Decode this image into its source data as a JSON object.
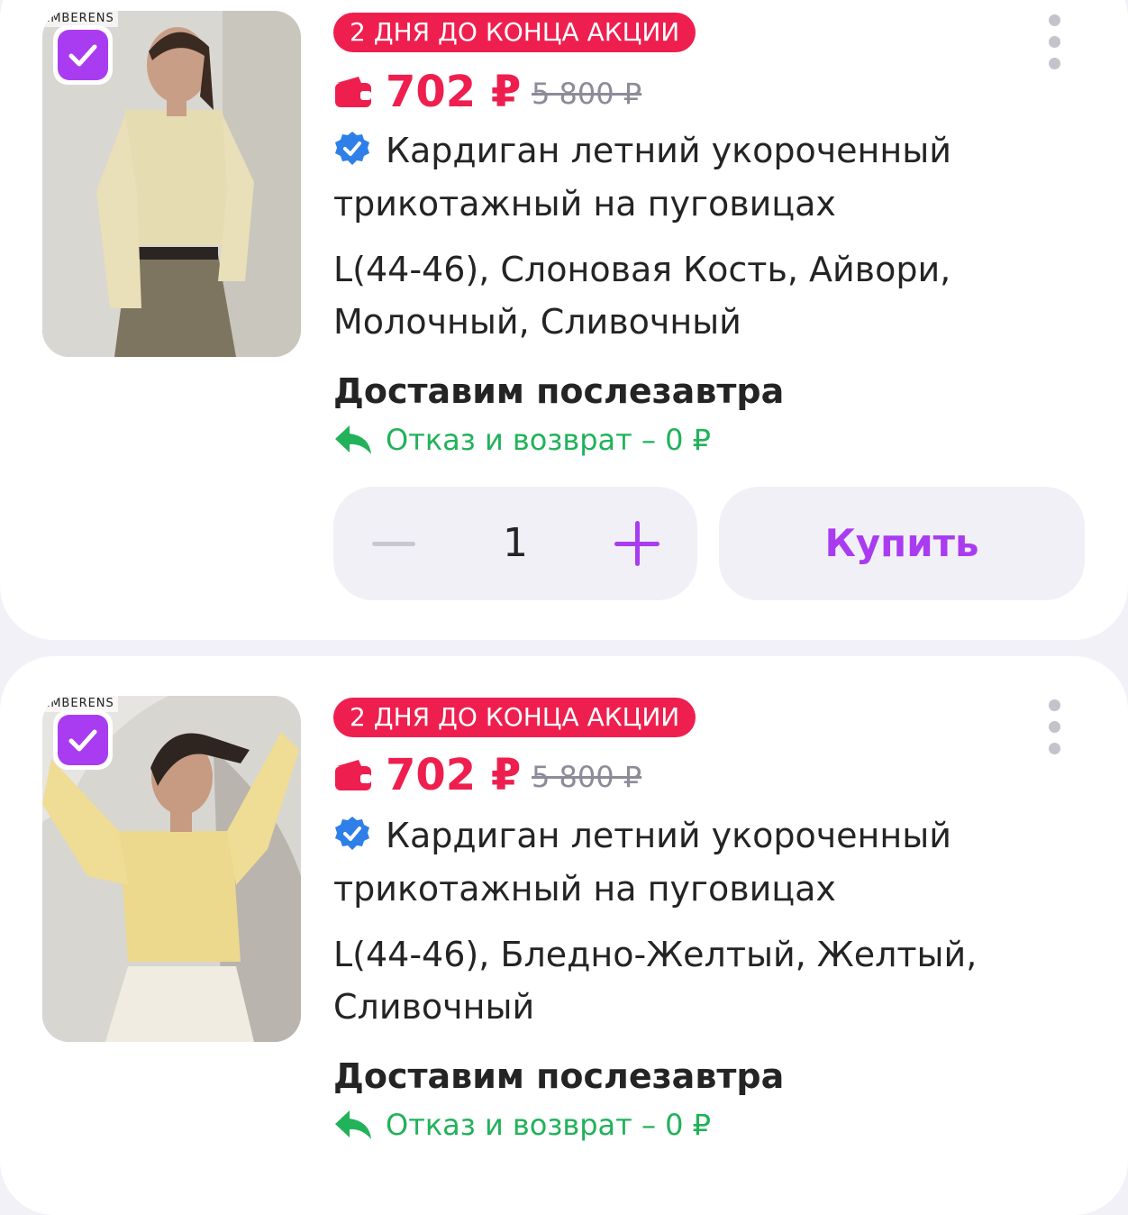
{
  "colors": {
    "accent": "#a93cf0",
    "sale": "#ee1f4e",
    "success": "#21b25a",
    "muted": "#8d8b98"
  },
  "products": [
    {
      "brand_mark": "EMBERENS",
      "selected": true,
      "promo_badge": "2 ДНЯ ДО КОНЦА АКЦИИ",
      "price": "702 ₽",
      "old_price": "5 800 ₽",
      "title": "Кардиган летний укороченный трикотажный на пуговицах",
      "variant": "L(44-46), Слоновая Кость, Айвори, Молочный, Сливочный",
      "delivery": "Доставим послезавтра",
      "return_policy": "Отказ и возврат – 0 ₽",
      "quantity": "1",
      "buy_label": "Купить",
      "icons": [
        "check-icon",
        "wallet-icon",
        "verified-icon",
        "return-arrow-icon",
        "more-vertical-icon",
        "minus-icon",
        "plus-icon"
      ]
    },
    {
      "brand_mark": "EMBERENS",
      "selected": true,
      "promo_badge": "2 ДНЯ ДО КОНЦА АКЦИИ",
      "price": "702 ₽",
      "old_price": "5 800 ₽",
      "title": "Кардиган летний укороченный трикотажный на пуговицах",
      "variant": "L(44-46), Бледно-Желтый, Желтый, Сливочный",
      "delivery": "Доставим послезавтра",
      "return_policy": "Отказ и возврат – 0 ₽",
      "icons": [
        "check-icon",
        "wallet-icon",
        "verified-icon",
        "return-arrow-icon",
        "more-vertical-icon"
      ]
    }
  ]
}
